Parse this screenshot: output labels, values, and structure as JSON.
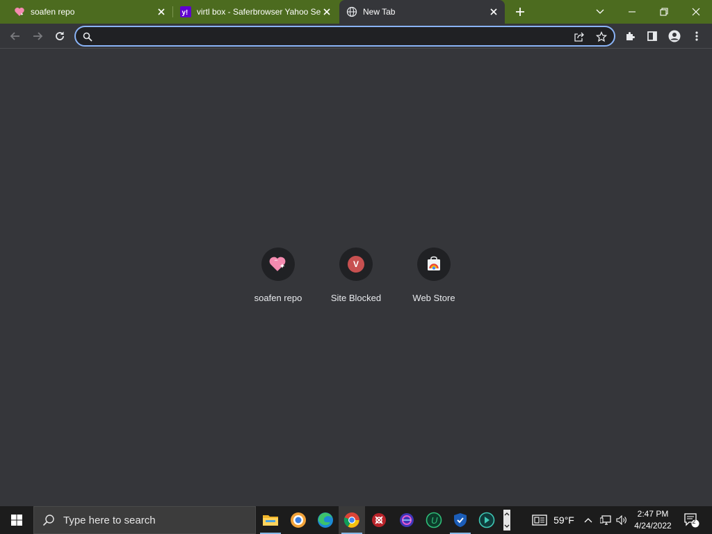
{
  "browser": {
    "tabs": [
      {
        "title": "soafen repo",
        "icon": "heart-favicon-icon",
        "active": false
      },
      {
        "title": "virtl box - Saferbrowser Yahoo Se",
        "icon": "yahoo-favicon-icon",
        "active": false
      },
      {
        "title": "New Tab",
        "icon": "globe-favicon-icon",
        "active": true
      }
    ],
    "omnibox": {
      "value": "",
      "placeholder": ""
    },
    "colors": {
      "tabstrip": "#4c6b1f",
      "page": "#35363a",
      "omnibox_border": "#8ab4f8"
    }
  },
  "shortcuts": [
    {
      "label": "soafen repo",
      "icon": "heart-sparkle-icon"
    },
    {
      "label": "Site Blocked",
      "icon": "letter-avatar-icon",
      "initial": "V",
      "color": "#c75050"
    },
    {
      "label": "Web Store",
      "icon": "web-store-icon"
    }
  ],
  "taskbar": {
    "search_placeholder": "Type here to search",
    "apps": [
      "file-explorer-icon",
      "chromium-icon",
      "edge-icon",
      "chrome-icon",
      "red-app-icon",
      "purple-app-icon",
      "green-u-app-icon",
      "shield-app-icon",
      "vpn-app-icon"
    ],
    "weather": "59°F",
    "time": "2:47 PM",
    "date": "4/24/2022",
    "notification_count": "2"
  }
}
